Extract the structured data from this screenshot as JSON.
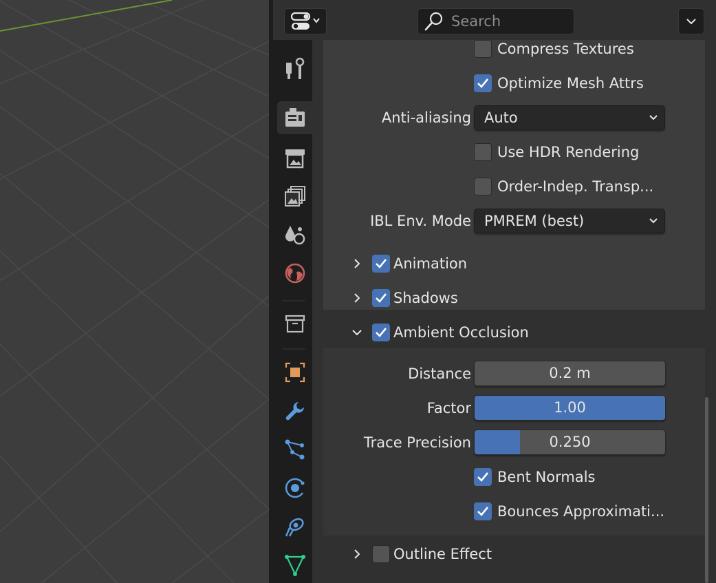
{
  "header": {
    "search_placeholder": "Search"
  },
  "tabs": [
    {
      "name": "tool-tab",
      "icon": "tool-icon"
    },
    {
      "name": "render-tab",
      "icon": "render-icon",
      "active": true
    },
    {
      "name": "output-tab",
      "icon": "output-icon"
    },
    {
      "name": "view-layer-tab",
      "icon": "view-layer-icon"
    },
    {
      "name": "scene-tab",
      "icon": "scene-icon"
    },
    {
      "name": "world-tab",
      "icon": "world-icon"
    },
    {
      "name": "collection-tab",
      "icon": "collection-icon"
    },
    {
      "name": "object-tab",
      "icon": "object-icon"
    },
    {
      "name": "modifiers-tab",
      "icon": "wrench-icon"
    },
    {
      "name": "particles-tab",
      "icon": "particles-icon"
    },
    {
      "name": "physics-tab",
      "icon": "physics-icon"
    },
    {
      "name": "constraints-tab",
      "icon": "constraints-icon"
    },
    {
      "name": "data-tab",
      "icon": "mesh-data-icon"
    }
  ],
  "settings": {
    "compress_textures": {
      "label": "Compress Textures",
      "checked": false
    },
    "optimize_mesh_attrs": {
      "label": "Optimize Mesh Attrs",
      "checked": true
    },
    "anti_aliasing": {
      "label": "Anti-aliasing",
      "value": "Auto"
    },
    "use_hdr_rendering": {
      "label": "Use HDR Rendering",
      "checked": false
    },
    "order_indep_transp": {
      "label": "Order-Indep. Transp...",
      "checked": false
    },
    "ibl_env_mode": {
      "label": "IBL Env. Mode",
      "value": "PMREM (best)"
    }
  },
  "subpanels": {
    "animation": {
      "label": "Animation",
      "checked": true,
      "expanded": false
    },
    "shadows": {
      "label": "Shadows",
      "checked": true,
      "expanded": false
    },
    "ambient_occlusion": {
      "label": "Ambient Occlusion",
      "checked": true,
      "expanded": true
    },
    "outline_effect": {
      "label": "Outline Effect",
      "checked": false,
      "expanded": false
    }
  },
  "ambient_occlusion": {
    "distance": {
      "label": "Distance",
      "value": "0.2 m"
    },
    "factor": {
      "label": "Factor",
      "value": "1.00",
      "fraction": 1.0
    },
    "trace_precision": {
      "label": "Trace Precision",
      "value": "0.250",
      "fraction": 0.24
    },
    "bent_normals": {
      "label": "Bent Normals",
      "checked": true
    },
    "bounces_approximation": {
      "label": "Bounces Approximati...",
      "checked": true
    }
  },
  "colors": {
    "accent": "#4772b3",
    "viewport_axis_x": "#6a9434"
  }
}
